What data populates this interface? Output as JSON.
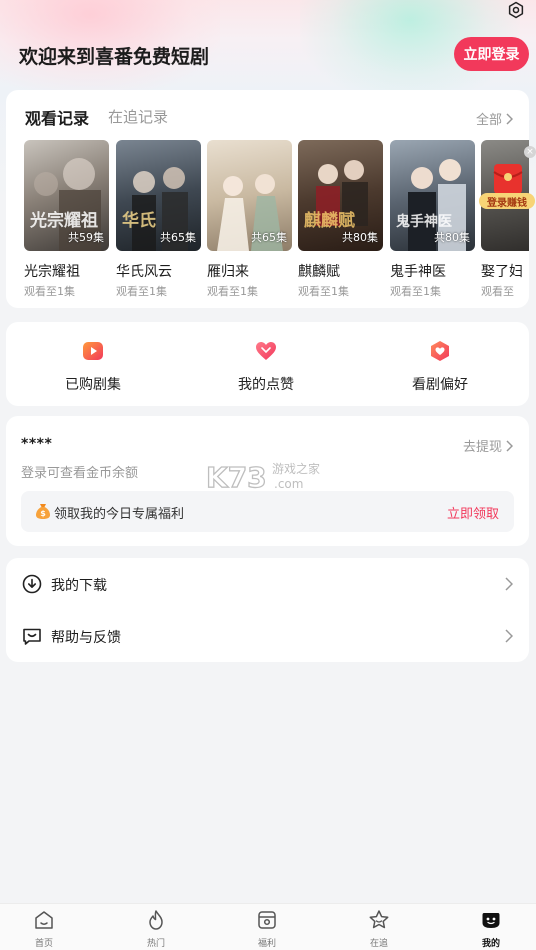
{
  "header": {
    "welcome": "欢迎来到喜番免费短剧",
    "login_button": "立即登录"
  },
  "history": {
    "tab_active": "观看记录",
    "tab_other": "在追记录",
    "view_all": "全部",
    "items": [
      {
        "title": "光宗耀祖",
        "progress": "观看至1集",
        "count": "共59集",
        "art": "光宗耀祖"
      },
      {
        "title": "华氏风云",
        "progress": "观看至1集",
        "count": "共65集",
        "art": "华氏"
      },
      {
        "title": "雁归来",
        "progress": "观看至1集",
        "count": "共65集",
        "art": ""
      },
      {
        "title": "麒麟赋",
        "progress": "观看至1集",
        "count": "共80集",
        "art": "麒麟赋"
      },
      {
        "title": "鬼手神医",
        "progress": "观看至1集",
        "count": "共80集",
        "art": "鬼手神医"
      },
      {
        "title": "娶了妇",
        "progress": "观看至",
        "count": "",
        "art": ""
      }
    ],
    "float_badge": {
      "label": "登录赚钱",
      "close": "×"
    }
  },
  "quick": {
    "items": [
      {
        "label": "已购剧集",
        "icon": "play-ticket-icon"
      },
      {
        "label": "我的点赞",
        "icon": "heart-icon"
      },
      {
        "label": "看剧偏好",
        "icon": "preference-heart-icon"
      }
    ]
  },
  "coins": {
    "amount": "****",
    "hint": "登录可查看金币余额",
    "withdraw": "去提现",
    "benefit_text": "领取我的今日专属福利",
    "benefit_action": "立即领取"
  },
  "watermark": {
    "brand": "K73",
    "cn": "游戏之家",
    "domain": ".com"
  },
  "menu": {
    "items": [
      {
        "label": "我的下载",
        "icon": "download-icon"
      },
      {
        "label": "帮助与反馈",
        "icon": "feedback-icon"
      }
    ]
  },
  "tabbar": {
    "items": [
      {
        "label": "首页",
        "icon": "home-icon"
      },
      {
        "label": "热门",
        "icon": "flame-icon"
      },
      {
        "label": "福利",
        "icon": "gift-icon"
      },
      {
        "label": "在追",
        "icon": "star-icon"
      },
      {
        "label": "我的",
        "icon": "profile-icon"
      }
    ],
    "active_index": 4
  },
  "colors": {
    "accent": "#f2395b",
    "muted": "#999999",
    "badge_gold": "#f7d476"
  }
}
